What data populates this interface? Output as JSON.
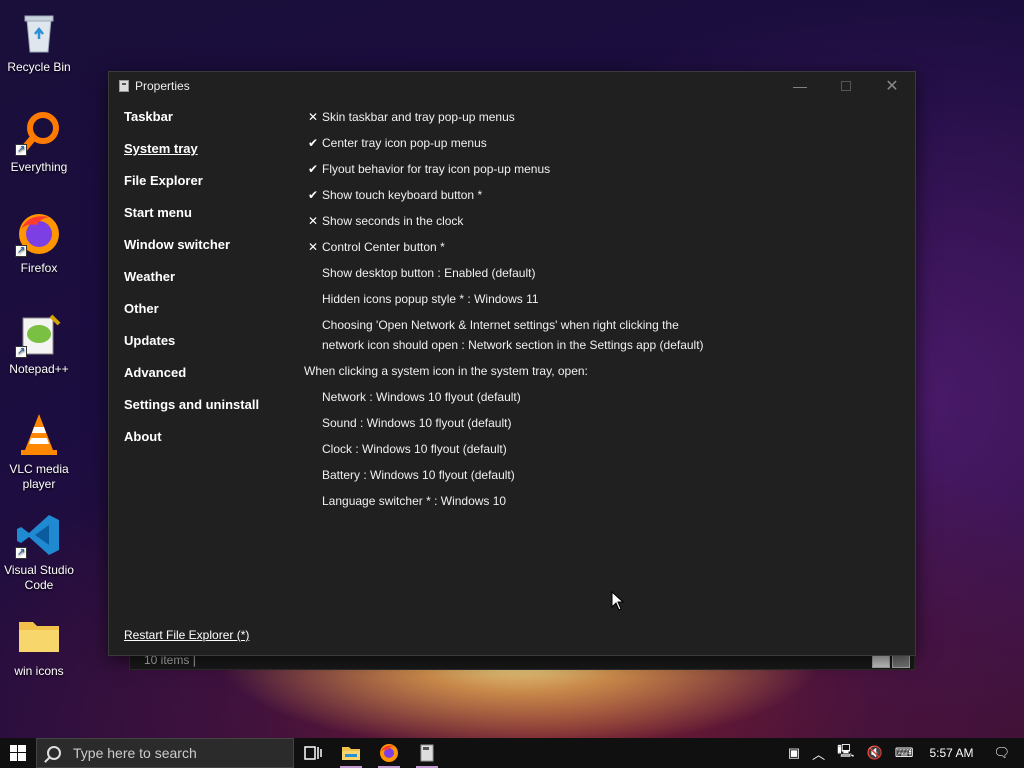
{
  "desktop": {
    "icons": [
      {
        "label": "Recycle Bin"
      },
      {
        "label": "Everything"
      },
      {
        "label": "Firefox"
      },
      {
        "label": "Notepad++"
      },
      {
        "label": "VLC media player"
      },
      {
        "label": "Visual Studio Code"
      },
      {
        "label": "win icons"
      }
    ]
  },
  "window": {
    "title": "Properties",
    "nav": [
      {
        "label": "Taskbar"
      },
      {
        "label": "System tray",
        "active": true
      },
      {
        "label": "File Explorer"
      },
      {
        "label": "Start menu"
      },
      {
        "label": "Window switcher"
      },
      {
        "label": "Weather"
      },
      {
        "label": "Other"
      },
      {
        "label": "Updates"
      },
      {
        "label": "Advanced"
      },
      {
        "label": "Settings and uninstall"
      },
      {
        "label": "About"
      }
    ],
    "options": [
      {
        "mark": "✕",
        "text": "Skin taskbar and tray pop-up menus"
      },
      {
        "mark": "✔",
        "text": "Center tray icon pop-up menus"
      },
      {
        "mark": "✔",
        "text": "Flyout behavior for tray icon pop-up menus"
      },
      {
        "mark": "✔",
        "text": "Show touch keyboard button *"
      },
      {
        "mark": "✕",
        "text": "Show seconds in the clock"
      },
      {
        "mark": "✕",
        "text": "Control Center button *"
      },
      {
        "mark": "",
        "text": "Show desktop button : Enabled (default)"
      },
      {
        "mark": "",
        "text": "Hidden icons popup style * : Windows 11"
      },
      {
        "mark": "",
        "text": "Choosing 'Open Network & Internet settings' when right clicking the network icon should open : Network section in the Settings app (default)",
        "multi": true
      }
    ],
    "group_label": "When clicking a system icon in the system tray, open:",
    "group_options": [
      {
        "text": "Network : Windows 10 flyout (default)"
      },
      {
        "text": "Sound : Windows 10 flyout (default)"
      },
      {
        "text": "Clock : Windows 10 flyout (default)"
      },
      {
        "text": "Battery : Windows 10 flyout (default)"
      },
      {
        "text": "Language switcher * : Windows 10"
      }
    ],
    "restart_link": "Restart File Explorer (*)"
  },
  "explorer": {
    "status": "10 items"
  },
  "taskbar": {
    "search_placeholder": "Type here to search",
    "clock": "5:57 AM"
  }
}
